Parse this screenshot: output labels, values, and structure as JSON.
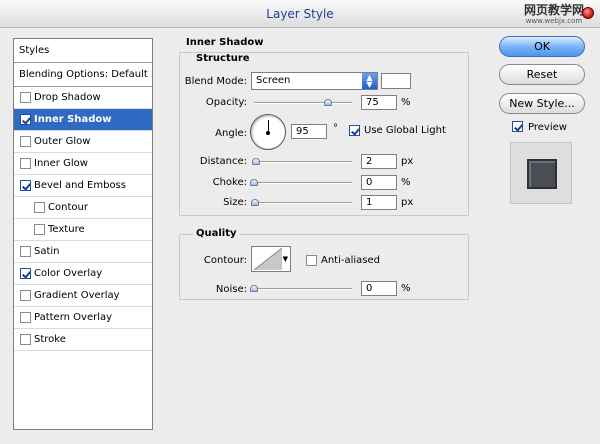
{
  "window": {
    "title": "Layer Style"
  },
  "watermark": {
    "main": "网页教学网",
    "sub": "www.webjx.com"
  },
  "styles_panel": {
    "header": "Styles",
    "blending": "Blending Options: Default",
    "items": [
      {
        "label": "Drop Shadow",
        "checked": false,
        "selected": false,
        "sub": false
      },
      {
        "label": "Inner Shadow",
        "checked": true,
        "selected": true,
        "sub": false
      },
      {
        "label": "Outer Glow",
        "checked": false,
        "selected": false,
        "sub": false
      },
      {
        "label": "Inner Glow",
        "checked": false,
        "selected": false,
        "sub": false
      },
      {
        "label": "Bevel and Emboss",
        "checked": true,
        "selected": false,
        "sub": false
      },
      {
        "label": "Contour",
        "checked": false,
        "selected": false,
        "sub": true
      },
      {
        "label": "Texture",
        "checked": false,
        "selected": false,
        "sub": true
      },
      {
        "label": "Satin",
        "checked": false,
        "selected": false,
        "sub": false
      },
      {
        "label": "Color Overlay",
        "checked": true,
        "selected": false,
        "sub": false
      },
      {
        "label": "Gradient Overlay",
        "checked": false,
        "selected": false,
        "sub": false
      },
      {
        "label": "Pattern Overlay",
        "checked": false,
        "selected": false,
        "sub": false
      },
      {
        "label": "Stroke",
        "checked": false,
        "selected": false,
        "sub": false
      }
    ]
  },
  "inner_shadow": {
    "section_title": "Inner Shadow",
    "structure": {
      "title": "Structure",
      "blend_mode": {
        "label": "Blend Mode:",
        "value": "Screen"
      },
      "opacity": {
        "label": "Opacity:",
        "value": "75",
        "unit": "%",
        "level": 0.75
      },
      "angle": {
        "label": "Angle:",
        "value": "95",
        "unit": "°",
        "use_global_light": "Use Global Light",
        "use_global_light_checked": true
      },
      "distance": {
        "label": "Distance:",
        "value": "2",
        "unit": "px",
        "level": 0.02
      },
      "choke": {
        "label": "Choke:",
        "value": "0",
        "unit": "%",
        "level": 0
      },
      "size": {
        "label": "Size:",
        "value": "1",
        "unit": "px",
        "level": 0.01
      }
    },
    "quality": {
      "title": "Quality",
      "contour": {
        "label": "Contour:",
        "anti_aliased": "Anti-aliased",
        "anti_aliased_checked": false
      },
      "noise": {
        "label": "Noise:",
        "value": "0",
        "unit": "%",
        "level": 0
      }
    }
  },
  "buttons": {
    "ok": "OK",
    "reset": "Reset",
    "new_style": "New Style...",
    "preview": "Preview",
    "preview_checked": true
  },
  "colors": {
    "selection": "#316ac5",
    "shadow_color": "#ffffff",
    "preview_swatch": "#4a4d53"
  }
}
